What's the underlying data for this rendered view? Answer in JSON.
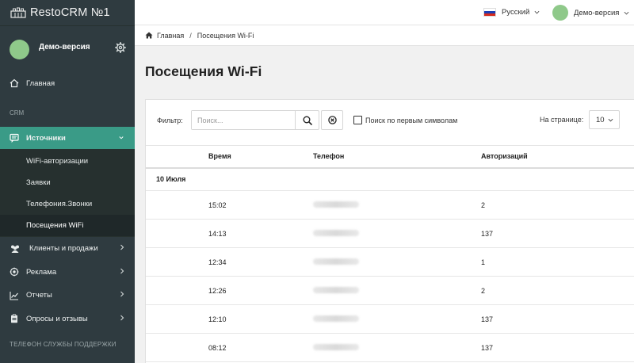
{
  "app": {
    "logo_text": "RestoCRM №1"
  },
  "profile": {
    "name": "Демо-версия"
  },
  "nav": {
    "home": "Главная",
    "section_crm": "CRM",
    "sources": "Источники",
    "sub_items": [
      "WiFi-авторизации",
      "Заявки",
      "Телефония.Звонки",
      "Посещения WiFi"
    ],
    "clients": "Клиенты и продажи",
    "ads": "Реклама",
    "reports": "Отчеты",
    "surveys": "Опросы и отзывы",
    "support": "ТЕЛЕФОН СЛУЖБЫ ПОДДЕРЖКИ"
  },
  "topbar": {
    "language": "Русский",
    "user": "Демо-версия"
  },
  "breadcrumb": {
    "home": "Главная",
    "separator": "/",
    "current": "Посещения Wi-Fi"
  },
  "page": {
    "title": "Посещения Wi-Fi"
  },
  "filter": {
    "label": "Фильтр:",
    "search_placeholder": "Поиск...",
    "first_chars_label": "Поиск по первым символам",
    "first_chars_checked": false,
    "per_page_label": "На странице:",
    "per_page_value": "10"
  },
  "table": {
    "columns": [
      "Время",
      "Телефон",
      "Авторизаций"
    ],
    "date_group": "10 Июля",
    "rows": [
      {
        "time": "15:02",
        "auth": "2"
      },
      {
        "time": "14:13",
        "auth": "137"
      },
      {
        "time": "12:34",
        "auth": "1"
      },
      {
        "time": "12:26",
        "auth": "2"
      },
      {
        "time": "12:10",
        "auth": "137"
      },
      {
        "time": "08:12",
        "auth": "137"
      }
    ]
  },
  "colors": {
    "sidebar": "#2f3b40",
    "accent": "#3a9b87",
    "avatar": "#8fc98a"
  }
}
